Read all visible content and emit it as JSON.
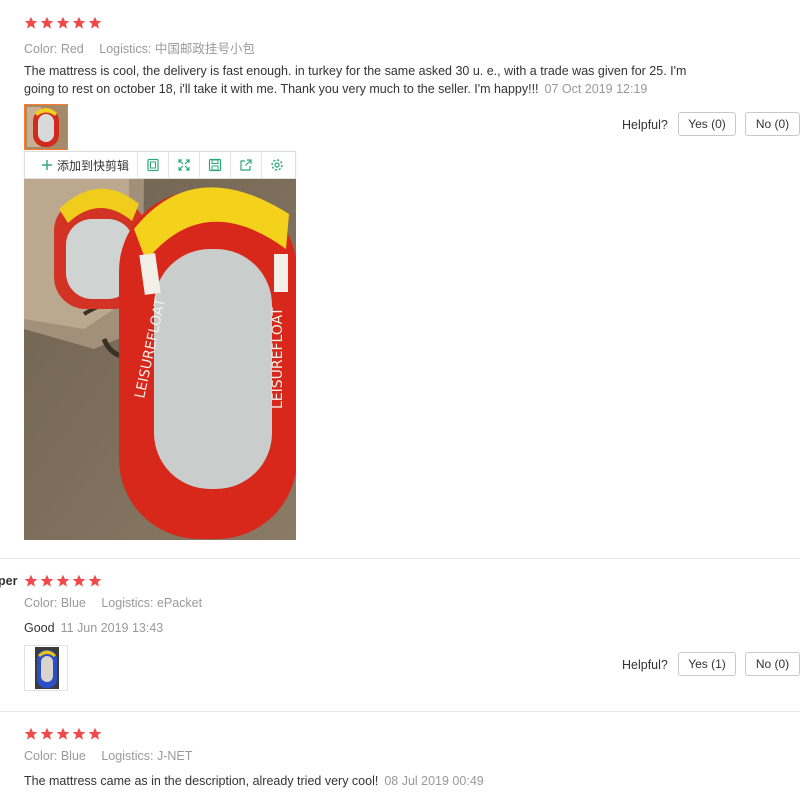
{
  "colors": {
    "star": "#f04a4a",
    "accent_border": "#ff7a2a",
    "toolbar_icon": "#2aa87a"
  },
  "reviews": [
    {
      "rating": 5,
      "color_label": "Color:",
      "color_value": "Red",
      "logistics_label": "Logistics:",
      "logistics_value": "中国邮政挂号小包",
      "text_line1": "The mattress is cool, the delivery is fast enough. in turkey for the same asked 30 u. e., with a trade was given for 25. I'm",
      "text_line2": "going to rest on october 18, i'll take it with me. Thank you very much to the seller. I'm happy!!!",
      "time": "07 Oct 2019 12:19",
      "helpful_label": "Helpful?",
      "yes_label": "Yes (0)",
      "no_label": "No (0)"
    },
    {
      "username": "per",
      "rating": 5,
      "color_label": "Color:",
      "color_value": "Blue",
      "logistics_label": "Logistics:",
      "logistics_value": "ePacket",
      "text_line1": "Good",
      "time": "11 Jun 2019 13:43",
      "helpful_label": "Helpful?",
      "yes_label": "Yes (1)",
      "no_label": "No (0)"
    },
    {
      "rating": 5,
      "color_label": "Color:",
      "color_value": "Blue",
      "logistics_label": "Logistics:",
      "logistics_value": "J-NET",
      "text_line1": "The mattress came as in the description, already tried very cool!",
      "time": "08 Jul 2019 00:49"
    }
  ],
  "image_toolbar": {
    "add_label": "添加到快剪辑",
    "icons": [
      "copy-icon",
      "expand-icon",
      "save-icon",
      "share-icon",
      "settings-icon"
    ]
  },
  "product_image": {
    "brand_text": "LEISUREFLOAT"
  }
}
